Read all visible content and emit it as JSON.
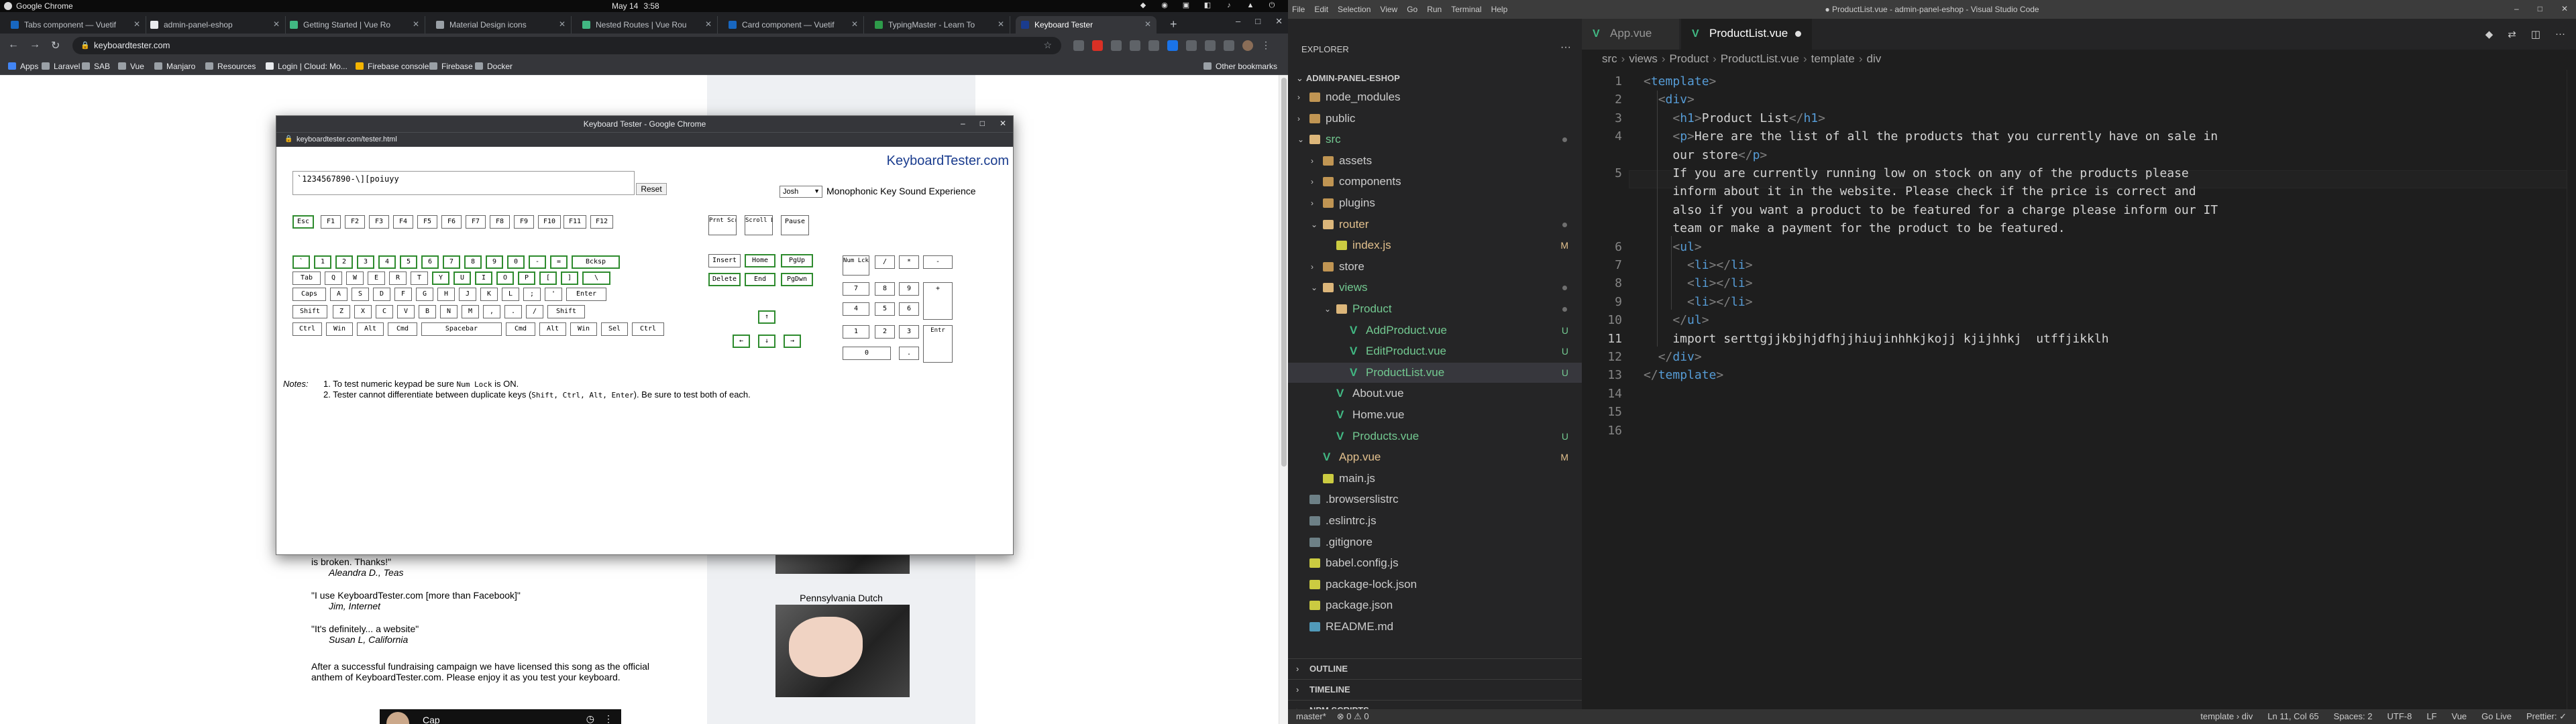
{
  "os": {
    "app_name": "Google Chrome",
    "date": "May 14",
    "time": "3:58 PM"
  },
  "chrome": {
    "tabs": [
      {
        "title": "Tabs component — Vuetif",
        "color": "#1867c0"
      },
      {
        "title": "admin-panel-eshop",
        "color": "#e8eaed"
      },
      {
        "title": "Getting Started | Vue Ro",
        "color": "#41b883"
      },
      {
        "title": "Material Design icons",
        "color": "#9aa0a6"
      },
      {
        "title": "Nested Routes | Vue Rou",
        "color": "#41b883"
      },
      {
        "title": "Card component — Vuetif",
        "color": "#1867c0"
      },
      {
        "title": "TypingMaster - Learn To",
        "color": "#2e9b4a"
      },
      {
        "title": "Keyboard Tester",
        "color": "#1a3c8e"
      }
    ],
    "url": "keyboardtester.com",
    "bookmarks": [
      {
        "label": "Apps",
        "color": "#4285f4"
      },
      {
        "label": "Laravel",
        "color": "#9aa0a6"
      },
      {
        "label": "SAB",
        "color": "#9aa0a6"
      },
      {
        "label": "Vue",
        "color": "#9aa0a6"
      },
      {
        "label": "Manjaro",
        "color": "#9aa0a6"
      },
      {
        "label": "Resources",
        "color": "#9aa0a6"
      },
      {
        "label": "Login | Cloud: Mo...",
        "color": "#e8eaed"
      },
      {
        "label": "Firebase console",
        "color": "#f4b400"
      },
      {
        "label": "Firebase",
        "color": "#9aa0a6"
      },
      {
        "label": "Docker",
        "color": "#9aa0a6"
      }
    ],
    "other_bookmarks": "Other bookmarks"
  },
  "page": {
    "quote0": "is broken. Thanks!\"",
    "quote0_by": "Aleandra D., Teas",
    "quote1": "\"I use KeyboardTester.com [more than Facebook]\"",
    "quote1_by": "Jim, Internet",
    "quote2": "\"It's definitely... a website\"",
    "quote2_by": "Susan L, California",
    "fundraising": "After a successful fundraising campaign we have licensed this song as the official anthem of KeyboardTester.com. Please enjoy it as you test your keyboard.",
    "video_title": "Cap",
    "caption": "Pennsylvania Dutch"
  },
  "popup": {
    "title": "Keyboard Tester - Google Chrome",
    "url": "keyboardtester.com/tester.html",
    "logo": "KeyboardTester.com",
    "typed_text": "`1234567890-\\][poiuyy",
    "reset_label": "Reset",
    "sound_select": "Josh",
    "sound_label": "Monophonic Key Sound Experience",
    "notes_label": "Notes:",
    "note1_a": "1. To test numeric keypad be sure ",
    "note1_code": "Num Lock",
    "note1_b": " is ON.",
    "note2_a": "2. Tester cannot differentiate between duplicate keys (",
    "note2_code": "Shift, Ctrl, Alt, Enter",
    "note2_b": "). Be sure to test both of each.",
    "keys": [
      {
        "label": "Esc",
        "on": true
      },
      {
        "label": "F1",
        "on": false
      },
      {
        "label": "F2",
        "on": false
      },
      {
        "label": "F3",
        "on": false
      },
      {
        "label": "F4",
        "on": false
      },
      {
        "label": "F5",
        "on": false
      },
      {
        "label": "F6",
        "on": false
      },
      {
        "label": "F7",
        "on": false
      },
      {
        "label": "F8",
        "on": false
      },
      {
        "label": "F9",
        "on": false
      },
      {
        "label": "F10",
        "on": false
      },
      {
        "label": "F11",
        "on": false
      },
      {
        "label": "F12",
        "on": false
      },
      {
        "label": "Prnt Scrn",
        "on": false
      },
      {
        "label": "Scroll Lock",
        "on": false
      },
      {
        "label": "Pause",
        "on": false
      },
      {
        "label": "`",
        "on": true
      },
      {
        "label": "1",
        "on": true
      },
      {
        "label": "2",
        "on": true
      },
      {
        "label": "3",
        "on": true
      },
      {
        "label": "4",
        "on": true
      },
      {
        "label": "5",
        "on": true
      },
      {
        "label": "6",
        "on": true
      },
      {
        "label": "7",
        "on": true
      },
      {
        "label": "8",
        "on": true
      },
      {
        "label": "9",
        "on": true
      },
      {
        "label": "0",
        "on": true
      },
      {
        "label": "-",
        "on": true
      },
      {
        "label": "=",
        "on": true
      },
      {
        "label": "Bcksp",
        "on": true
      },
      {
        "label": "Tab",
        "on": false
      },
      {
        "label": "Q",
        "on": false
      },
      {
        "label": "W",
        "on": false
      },
      {
        "label": "E",
        "on": false
      },
      {
        "label": "R",
        "on": false
      },
      {
        "label": "T",
        "on": false
      },
      {
        "label": "Y",
        "on": true
      },
      {
        "label": "U",
        "on": true
      },
      {
        "label": "I",
        "on": true
      },
      {
        "label": "O",
        "on": true
      },
      {
        "label": "P",
        "on": true
      },
      {
        "label": "[",
        "on": true
      },
      {
        "label": "]",
        "on": true
      },
      {
        "label": "\\",
        "on": true
      },
      {
        "label": "Caps",
        "on": false
      },
      {
        "label": "A",
        "on": false
      },
      {
        "label": "S",
        "on": false
      },
      {
        "label": "D",
        "on": false
      },
      {
        "label": "F",
        "on": false
      },
      {
        "label": "G",
        "on": false
      },
      {
        "label": "H",
        "on": false
      },
      {
        "label": "J",
        "on": false
      },
      {
        "label": "K",
        "on": false
      },
      {
        "label": "L",
        "on": false
      },
      {
        "label": ";",
        "on": false
      },
      {
        "label": "'",
        "on": false
      },
      {
        "label": "Enter",
        "on": false
      },
      {
        "label": "Shift",
        "on": false
      },
      {
        "label": "Z",
        "on": false
      },
      {
        "label": "X",
        "on": false
      },
      {
        "label": "C",
        "on": false
      },
      {
        "label": "V",
        "on": false
      },
      {
        "label": "B",
        "on": false
      },
      {
        "label": "N",
        "on": false
      },
      {
        "label": "M",
        "on": false
      },
      {
        "label": ",",
        "on": false
      },
      {
        "label": ".",
        "on": false
      },
      {
        "label": "/",
        "on": false
      },
      {
        "label": "Shift",
        "on": false
      },
      {
        "label": "Ctrl",
        "on": false
      },
      {
        "label": "Win",
        "on": false
      },
      {
        "label": "Alt",
        "on": false
      },
      {
        "label": "Cmd",
        "on": false
      },
      {
        "label": "Spacebar",
        "on": false
      },
      {
        "label": "Cmd",
        "on": false
      },
      {
        "label": "Alt",
        "on": false
      },
      {
        "label": "Win",
        "on": false
      },
      {
        "label": "Sel",
        "on": false
      },
      {
        "label": "Ctrl",
        "on": false
      },
      {
        "label": "Insert",
        "on": false
      },
      {
        "label": "Home",
        "on": true
      },
      {
        "label": "PgUp",
        "on": true
      },
      {
        "label": "Delete",
        "on": true
      },
      {
        "label": "End",
        "on": true
      },
      {
        "label": "PgDwn",
        "on": true
      },
      {
        "label": "↑",
        "on": true
      },
      {
        "label": "←",
        "on": true
      },
      {
        "label": "↓",
        "on": true
      },
      {
        "label": "→",
        "on": true
      },
      {
        "label": "Num Lck",
        "on": false
      },
      {
        "label": "/",
        "on": false
      },
      {
        "label": "*",
        "on": false
      },
      {
        "label": "-",
        "on": false
      },
      {
        "label": "7",
        "on": false
      },
      {
        "label": "8",
        "on": false
      },
      {
        "label": "9",
        "on": false
      },
      {
        "label": "+",
        "on": false
      },
      {
        "label": "4",
        "on": false
      },
      {
        "label": "5",
        "on": false
      },
      {
        "label": "6",
        "on": false
      },
      {
        "label": "1",
        "on": false
      },
      {
        "label": "2",
        "on": false
      },
      {
        "label": "3",
        "on": false
      },
      {
        "label": "Entr",
        "on": false
      },
      {
        "label": "0",
        "on": false
      },
      {
        "label": ".",
        "on": false
      }
    ]
  },
  "vscode": {
    "window_title": "● ProductList.vue - admin-panel-eshop - Visual Studio Code",
    "menu": [
      "File",
      "Edit",
      "Selection",
      "View",
      "Go",
      "Run",
      "Terminal",
      "Help"
    ],
    "explorer_label": "EXPLORER",
    "project": "ADMIN-PANEL-ESHOP",
    "tree": [
      {
        "name": "node_modules",
        "type": "folder",
        "status": "",
        "color": "#cccccc"
      },
      {
        "name": "public",
        "type": "folder",
        "status": "",
        "color": "#cccccc"
      },
      {
        "name": "src",
        "type": "folder-open",
        "status": "dot",
        "color": "#73c991"
      },
      {
        "name": "assets",
        "type": "folder",
        "status": "",
        "color": "#cccccc"
      },
      {
        "name": "components",
        "type": "folder",
        "status": "",
        "color": "#cccccc"
      },
      {
        "name": "plugins",
        "type": "folder",
        "status": "",
        "color": "#cccccc"
      },
      {
        "name": "router",
        "type": "folder-open",
        "status": "dot",
        "color": "#e2c08d"
      },
      {
        "name": "index.js",
        "type": "js",
        "status": "M",
        "color": "#e2c08d"
      },
      {
        "name": "store",
        "type": "folder",
        "status": "",
        "color": "#cccccc"
      },
      {
        "name": "views",
        "type": "folder-open",
        "status": "dot",
        "color": "#73c991"
      },
      {
        "name": "Product",
        "type": "folder-open",
        "status": "dot",
        "color": "#73c991"
      },
      {
        "name": "AddProduct.vue",
        "type": "vue",
        "status": "U",
        "color": "#73c991"
      },
      {
        "name": "EditProduct.vue",
        "type": "vue",
        "status": "U",
        "color": "#73c991"
      },
      {
        "name": "ProductList.vue",
        "type": "vue",
        "status": "U",
        "color": "#73c991"
      },
      {
        "name": "About.vue",
        "type": "vue",
        "status": "",
        "color": "#cccccc"
      },
      {
        "name": "Home.vue",
        "type": "vue",
        "status": "",
        "color": "#cccccc"
      },
      {
        "name": "Products.vue",
        "type": "vue",
        "status": "U",
        "color": "#73c991"
      },
      {
        "name": "App.vue",
        "type": "vue",
        "status": "M",
        "color": "#e2c08d"
      },
      {
        "name": "main.js",
        "type": "js",
        "status": "",
        "color": "#cccccc"
      },
      {
        "name": ".browserslistrc",
        "type": "cfg",
        "status": "",
        "color": "#cccccc"
      },
      {
        "name": ".eslintrc.js",
        "type": "cfg",
        "status": "",
        "color": "#cccccc"
      },
      {
        "name": ".gitignore",
        "type": "cfg",
        "status": "",
        "color": "#cccccc"
      },
      {
        "name": "babel.config.js",
        "type": "js",
        "status": "",
        "color": "#cccccc"
      },
      {
        "name": "package-lock.json",
        "type": "json",
        "status": "",
        "color": "#cccccc"
      },
      {
        "name": "package.json",
        "type": "json",
        "status": "",
        "color": "#cccccc"
      },
      {
        "name": "README.md",
        "type": "md",
        "status": "",
        "color": "#cccccc"
      }
    ],
    "sections": [
      "OUTLINE",
      "TIMELINE",
      "NPM SCRIPTS"
    ],
    "tabs": [
      {
        "label": "App.vue",
        "active": false,
        "modified": false
      },
      {
        "label": "ProductList.vue",
        "active": true,
        "modified": true
      }
    ],
    "breadcrumb": [
      "src",
      "views",
      "Product",
      "ProductList.vue",
      "template",
      "div"
    ],
    "code": [
      "<template>",
      "  <div>",
      "    <h1>Product List</h1>",
      "    <p>Here are the list of all the products that you currently have on sale in",
      "    our store</p>",
      "    If you are currently running low on stock on any of the products please",
      "    inform about it in the website. Please check if the price is correct and",
      "    also if you want a product to be featured for a charge please inform our IT",
      "    team or make a payment for the product to be featured.",
      "    <ul>",
      "      <li></li>",
      "      <li></li>",
      "      <li></li>",
      "    </ul>",
      "    import serttgjjkbjhjdfhjjhiujinhhkjkojj kjijhhkj  utffjikklh",
      "  </div>",
      "</template>",
      "",
      "",
      ""
    ],
    "line_numbers": [
      "1",
      "2",
      "3",
      "4",
      "",
      "5",
      "",
      "",
      "",
      "6",
      "7",
      "8",
      "9",
      "10",
      "11",
      "12",
      "13",
      "14",
      "15",
      "16"
    ],
    "status_left": [
      "master*",
      "⊗ 0 ⚠ 0"
    ],
    "status_right": [
      "template › div",
      "Ln 11, Col 65",
      "Spaces: 2",
      "UTF-8",
      "LF",
      "Vue",
      "Go Live",
      "Prettier: ✓"
    ]
  }
}
